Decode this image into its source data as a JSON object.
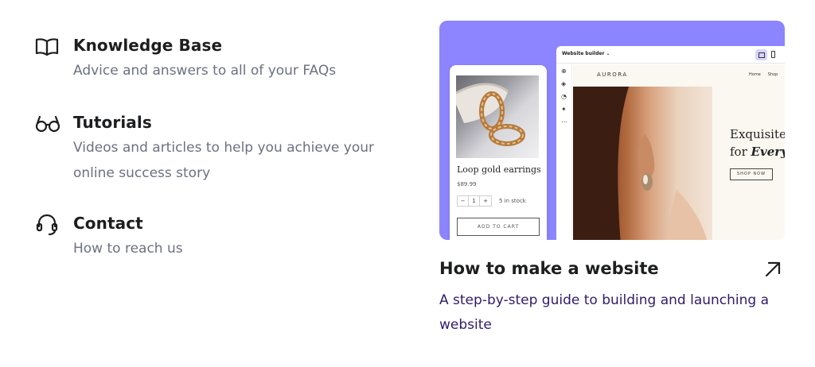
{
  "resources": [
    {
      "icon": "book-icon",
      "title": "Knowledge Base",
      "description": "Advice and answers to all of your FAQs"
    },
    {
      "icon": "glasses-icon",
      "title": "Tutorials",
      "description": "Videos and articles to help you achieve your online success story"
    },
    {
      "icon": "headset-icon",
      "title": "Contact",
      "description": "How to reach us"
    }
  ],
  "card": {
    "title": "How to make a website",
    "description": "A step-by-step guide to building and launching a website",
    "arrow_icon": "arrow-up-right-icon",
    "accent_color": "#8c85ff",
    "preview": {
      "product_name": "Loop gold earrings",
      "product_price": "$89.99",
      "qty_minus": "−",
      "qty_value": "1",
      "qty_plus": "+",
      "stock_text": "5 in stock",
      "add_to_cart": "ADD TO CART",
      "builder_label": "Website builder",
      "site_brand": "AURORA",
      "nav_home": "Home",
      "nav_shop": "Shop",
      "headline_line1": "Exquisite",
      "headline_line2_prefix": "for",
      "headline_line2_emphasis": "Every",
      "shop_now": "SHOP NOW"
    }
  }
}
